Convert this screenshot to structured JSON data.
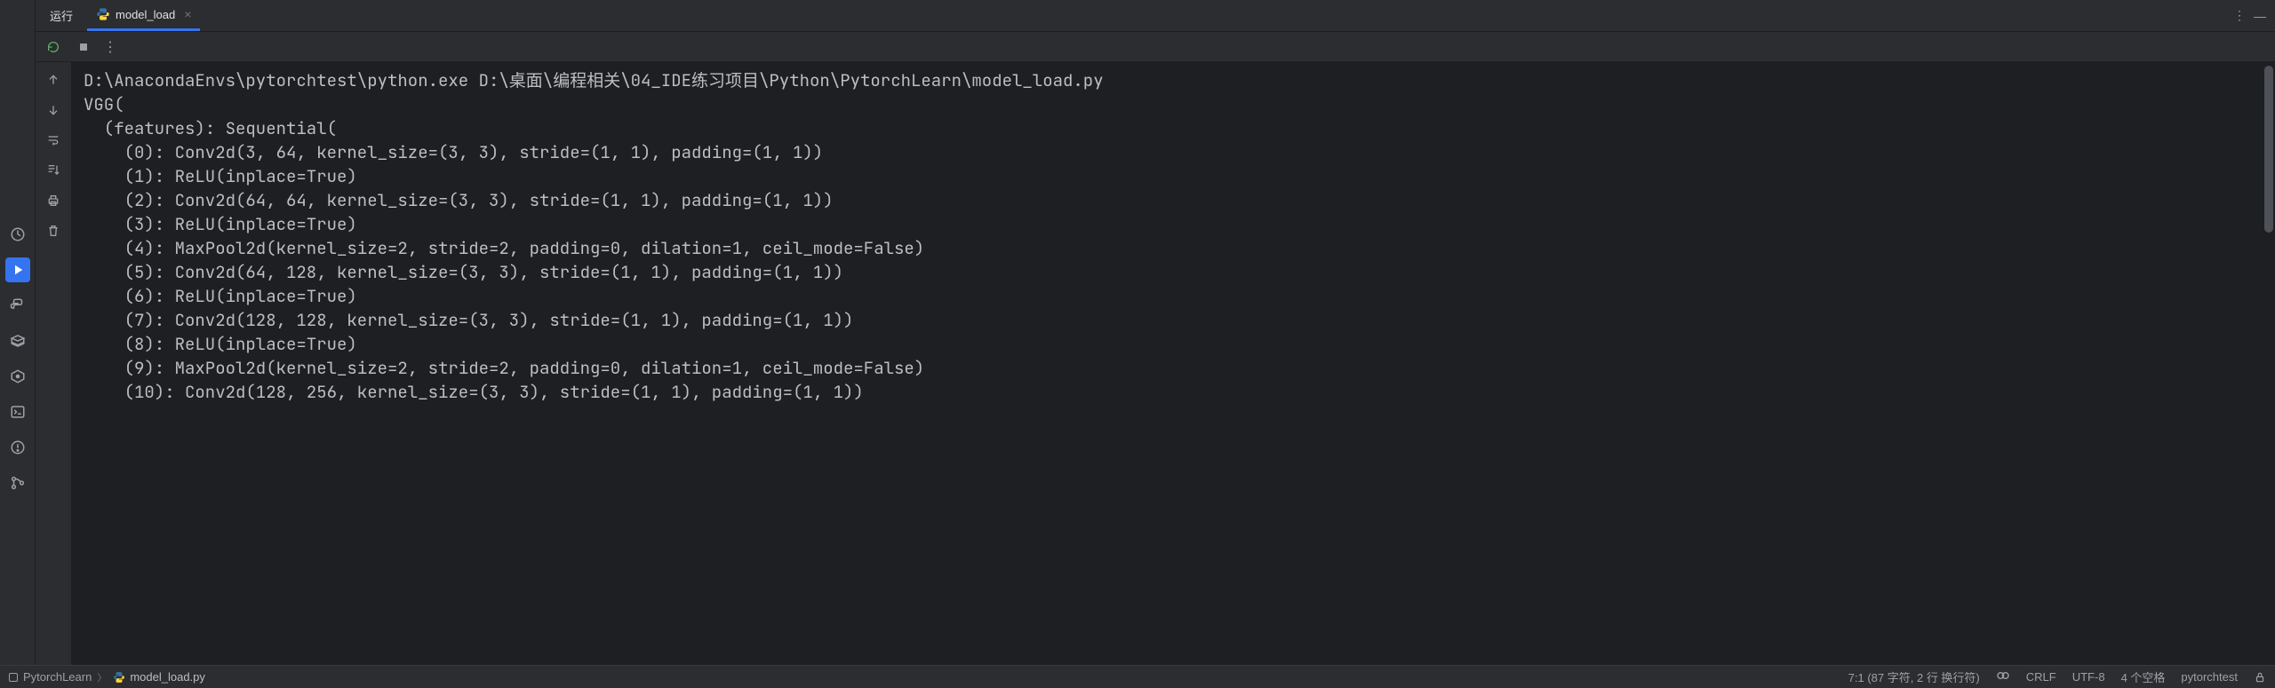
{
  "tab_bar": {
    "run_label": "运行",
    "tab_name": "model_load"
  },
  "console": {
    "lines": [
      "D:\\AnacondaEnvs\\pytorchtest\\python.exe D:\\桌面\\编程相关\\04_IDE练习项目\\Python\\PytorchLearn\\model_load.py",
      "VGG(",
      "  (features): Sequential(",
      "    (0): Conv2d(3, 64, kernel_size=(3, 3), stride=(1, 1), padding=(1, 1))",
      "    (1): ReLU(inplace=True)",
      "    (2): Conv2d(64, 64, kernel_size=(3, 3), stride=(1, 1), padding=(1, 1))",
      "    (3): ReLU(inplace=True)",
      "    (4): MaxPool2d(kernel_size=2, stride=2, padding=0, dilation=1, ceil_mode=False)",
      "    (5): Conv2d(64, 128, kernel_size=(3, 3), stride=(1, 1), padding=(1, 1))",
      "    (6): ReLU(inplace=True)",
      "    (7): Conv2d(128, 128, kernel_size=(3, 3), stride=(1, 1), padding=(1, 1))",
      "    (8): ReLU(inplace=True)",
      "    (9): MaxPool2d(kernel_size=2, stride=2, padding=0, dilation=1, ceil_mode=False)",
      "    (10): Conv2d(128, 256, kernel_size=(3, 3), stride=(1, 1), padding=(1, 1))"
    ]
  },
  "status_bar": {
    "project": "PytorchLearn",
    "file": "model_load.py",
    "cursor": "7:1 (87 字符, 2 行 换行符)",
    "line_sep": "CRLF",
    "encoding": "UTF-8",
    "indent": "4 个空格",
    "interpreter": "pytorchtest"
  }
}
